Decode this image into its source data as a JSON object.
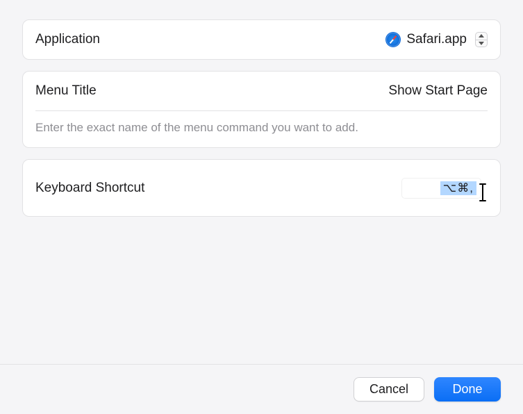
{
  "application": {
    "label": "Application",
    "selected_app": "Safari.app"
  },
  "menu_title": {
    "label": "Menu Title",
    "value": "Show Start Page",
    "helper": "Enter the exact name of the menu command you want to add."
  },
  "keyboard_shortcut": {
    "label": "Keyboard Shortcut",
    "value": "⌥⌘,"
  },
  "footer": {
    "cancel_label": "Cancel",
    "done_label": "Done"
  }
}
